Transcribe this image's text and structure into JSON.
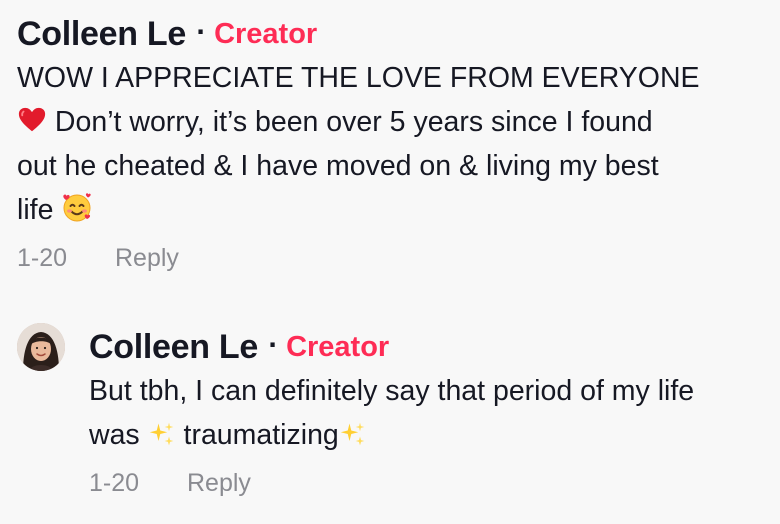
{
  "parent_comment": {
    "username": "Colleen Le",
    "separator": "·",
    "badge": "Creator",
    "text_lines": [
      "WOW I APPRECIATE THE LOVE FROM EVERYONE",
      "Don’t worry, it’s been over 5 years since I found",
      "out he cheated & I have moved on & living my best",
      "life"
    ],
    "emojis": [
      "red-heart",
      "smiling-face-with-hearts"
    ],
    "date": "1-20",
    "reply_label": "Reply"
  },
  "reply_comment": {
    "username": "Colleen Le",
    "separator": "·",
    "badge": "Creator",
    "text_lines": [
      "But tbh, I can definitely say that period of my life",
      "was",
      "traumatizing"
    ],
    "emojis": [
      "sparkles",
      "sparkles"
    ],
    "date": "1-20",
    "reply_label": "Reply"
  },
  "colors": {
    "background": "#f8f8f8",
    "text": "#161823",
    "creator_badge": "#fe2c55",
    "meta": "#8a8b91"
  }
}
